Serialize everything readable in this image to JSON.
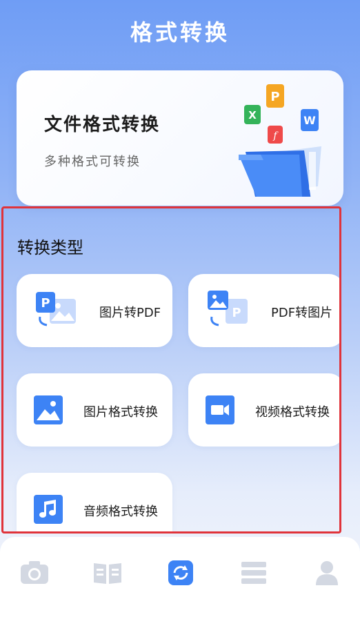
{
  "header": {
    "title": "格式转换"
  },
  "banner": {
    "title": "文件格式转换",
    "subtitle": "多种格式可转换",
    "art_letters": {
      "p": "P",
      "x": "X",
      "w": "W",
      "f": "f"
    }
  },
  "section": {
    "title": "转换类型",
    "cards": [
      {
        "label": "图片转PDF",
        "icon": "image-to-pdf-icon"
      },
      {
        "label": "PDF转图片",
        "icon": "pdf-to-image-icon"
      },
      {
        "label": "图片格式转换",
        "icon": "image-icon"
      },
      {
        "label": "视频格式转换",
        "icon": "video-camera-icon"
      },
      {
        "label": "音频格式转换",
        "icon": "music-note-icon"
      }
    ],
    "pdf_letter": "P"
  },
  "tabbar": {
    "tabs": [
      {
        "icon": "camera-icon",
        "active": false
      },
      {
        "icon": "book-icon",
        "active": false
      },
      {
        "icon": "convert-icon",
        "active": true
      },
      {
        "icon": "list-icon",
        "active": false
      },
      {
        "icon": "person-icon",
        "active": false
      }
    ]
  },
  "colors": {
    "accent": "#3d83f5",
    "tab_inactive": "#d3d8e2",
    "highlight_border": "#e0333a"
  }
}
